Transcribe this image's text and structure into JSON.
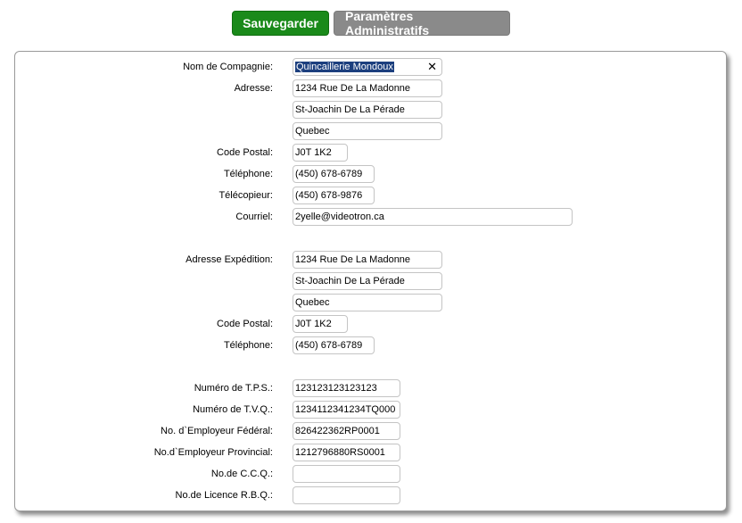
{
  "toolbar": {
    "save_label": "Sauvegarder",
    "admin_label": "Paramètres Administratifs"
  },
  "company": {
    "name_label": "Nom de Compagnie:",
    "name_value": "Quincaillerie Mondoux",
    "address_label": "Adresse:",
    "address_line1": "1234 Rue De La Madonne",
    "address_line2": "St-Joachin De La Pérade",
    "address_line3": "Quebec",
    "postal_label": "Code Postal:",
    "postal_value": "J0T 1K2",
    "phone_label": "Téléphone:",
    "phone_value": "(450) 678-6789",
    "fax_label": "Télécopieur:",
    "fax_value": "(450) 678-9876",
    "email_label": "Courriel:",
    "email_value": "2yelle@videotron.ca"
  },
  "shipping": {
    "address_label": "Adresse Expédition:",
    "address_line1": "1234 Rue De La Madonne",
    "address_line2": "St-Joachin De La Pérade",
    "address_line3": "Quebec",
    "postal_label": "Code Postal:",
    "postal_value": "J0T 1K2",
    "phone_label": "Téléphone:",
    "phone_value": "(450) 678-6789"
  },
  "tax": {
    "tps_label": "Numéro de T.P.S.:",
    "tps_value": "123123123123123",
    "tvq_label": "Numéro de T.V.Q.:",
    "tvq_value": "1234112341234TQ000",
    "federal_label": "No. d`Employeur Fédéral:",
    "federal_value": "826422362RP0001",
    "provincial_label": "No.d`Employeur Provincial:",
    "provincial_value": "1212796880RS0001",
    "ccq_label": "No.de C.C.Q.:",
    "ccq_value": "",
    "rbq_label": "No.de Licence R.B.Q.:",
    "rbq_value": ""
  }
}
